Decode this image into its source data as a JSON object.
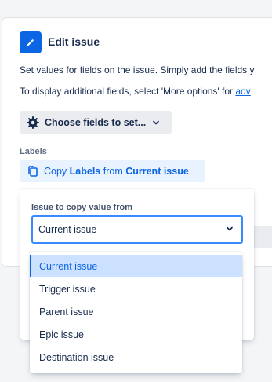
{
  "card": {
    "title": "Edit issue",
    "description_line1": "Set values for fields on the issue. Simply add the fields y",
    "description_line2_prefix": "To display additional fields, select 'More options' for ",
    "description_line2_link": "adv",
    "choose_fields_label": "Choose fields to set...",
    "labels_heading": "Labels",
    "copy_button": {
      "prefix": "Copy ",
      "field": "Labels",
      "middle": " from ",
      "source": "Current issue"
    }
  },
  "popover": {
    "label": "Issue to copy value from",
    "selected_value": "Current issue"
  },
  "dropdown": {
    "options": [
      "Current issue",
      "Trigger issue",
      "Parent issue",
      "Epic issue",
      "Destination issue"
    ],
    "selected_index": 0
  },
  "icons": {
    "edit": "pencil-icon",
    "choose": "gear-icon",
    "copy": "copy-icon",
    "chevron": "chevron-down-icon"
  },
  "colors": {
    "accent": "#0c66e4",
    "selected_bg": "#cce0ff",
    "page_bg": "#f4f5f7"
  }
}
